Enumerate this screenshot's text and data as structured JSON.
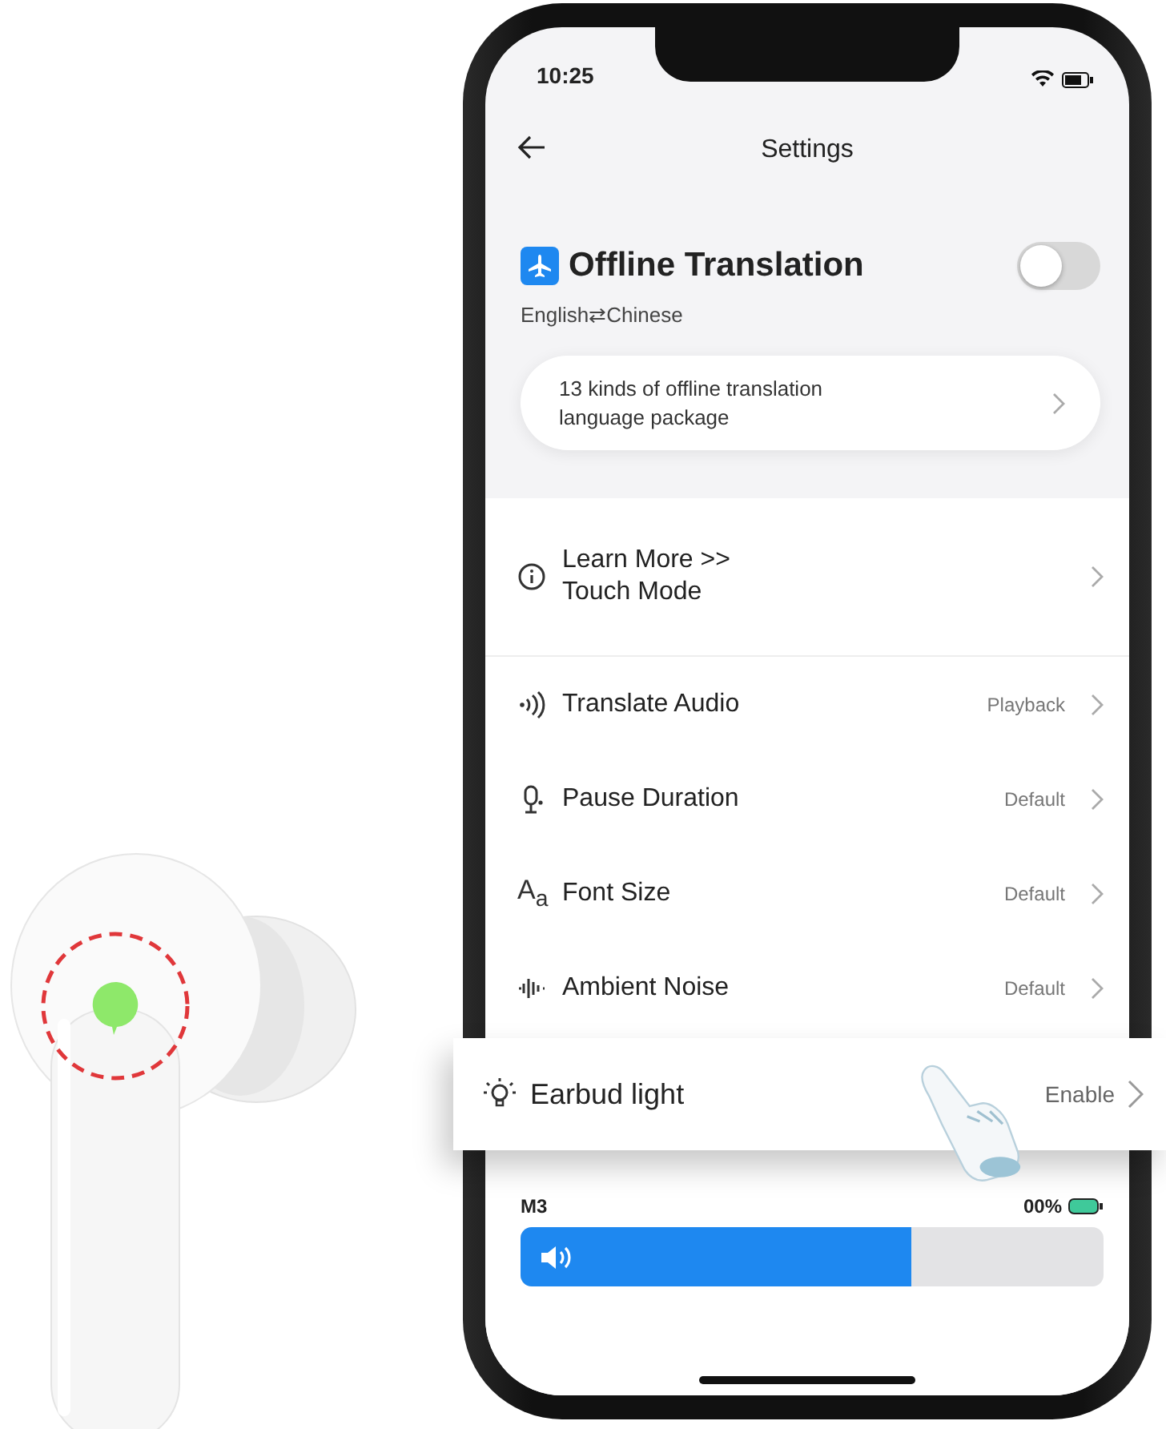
{
  "status_bar": {
    "time": "10:25"
  },
  "header": {
    "title": "Settings"
  },
  "offline_translation": {
    "title": "Offline Translation",
    "on": false,
    "languages": "English⇄Chinese",
    "package_link": "13 kinds of offline translation language package"
  },
  "settings": [
    {
      "kind": "info",
      "label": "Learn More >>",
      "sublabel": "Touch Mode"
    },
    {
      "kind": "audio",
      "label": "Translate Audio",
      "value": "Playback"
    },
    {
      "kind": "mic",
      "label": "Pause Duration",
      "value": "Default"
    },
    {
      "kind": "font",
      "glyph": "A$_{a}$",
      "label": "Font Size",
      "value": "Default"
    },
    {
      "kind": "noise",
      "label": "Ambient Noise",
      "value": "Default"
    }
  ],
  "highlighted_setting": {
    "label": "Earbud light",
    "value": "Enable"
  },
  "device": {
    "name": "M3",
    "battery": "00%",
    "level": 0.67
  }
}
